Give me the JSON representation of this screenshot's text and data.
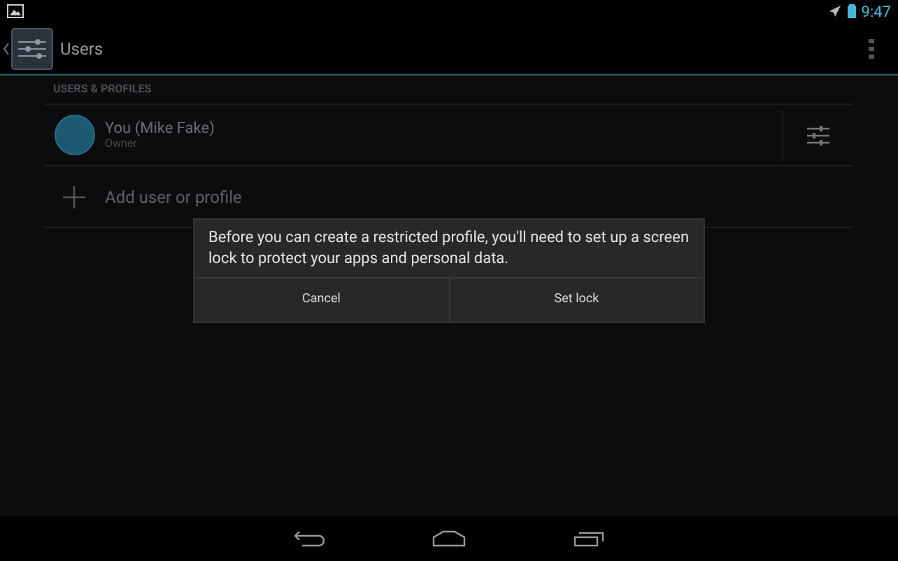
{
  "status_bar": {
    "time": "9:47"
  },
  "action_bar": {
    "title": "Users"
  },
  "section": {
    "header": "USERS & PROFILES"
  },
  "users": [
    {
      "name": "You (Mike Fake)",
      "role": "Owner"
    }
  ],
  "add_item": {
    "label": "Add user or profile"
  },
  "dialog": {
    "message": "Before you can create a restricted profile, you'll need to set up a screen lock to protect your apps and personal data.",
    "buttons": [
      "Cancel",
      "Set lock"
    ]
  }
}
